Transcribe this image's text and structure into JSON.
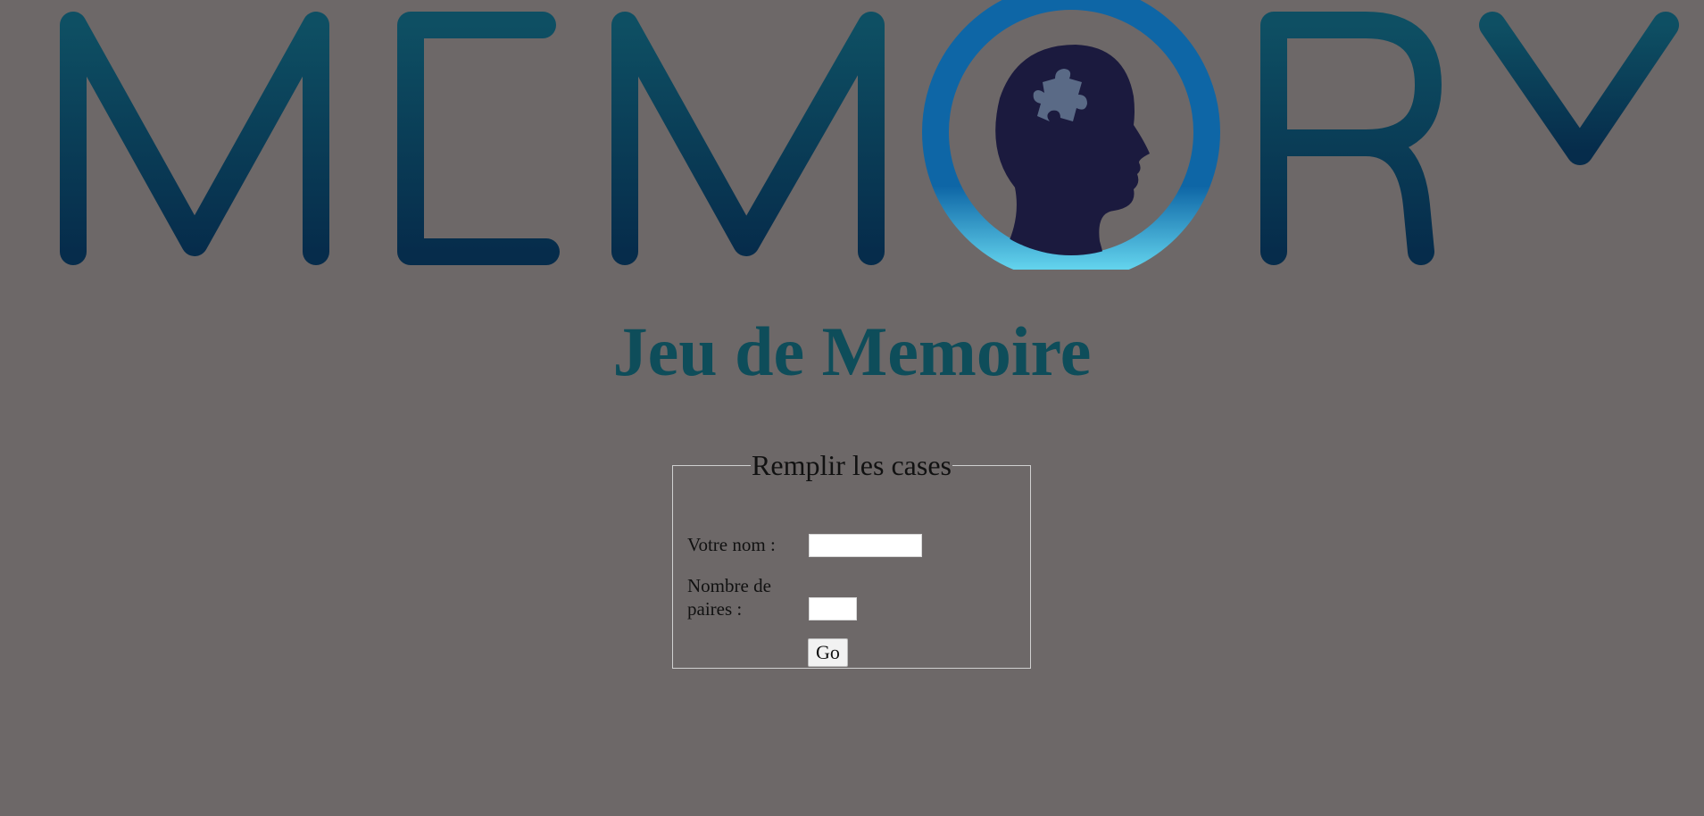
{
  "logo": {
    "text": "MEMORY",
    "icon": "head-puzzle-icon",
    "colors": {
      "letters_top": "#0e4f63",
      "letters_bottom": "#062c4b",
      "ring": "#0e66a6",
      "ring_bottom": "#62d2ec",
      "head": "#1b1a3e",
      "puzzle": "#5a6a86"
    }
  },
  "header": {
    "title": "Jeu de Memoire",
    "title_color": "#0e4d5a"
  },
  "form": {
    "legend": "Remplir les cases",
    "name_label": "Votre nom :",
    "name_value": "",
    "pairs_label": "Nombre de paires :",
    "pairs_value": "",
    "submit_label": "Go"
  },
  "colors": {
    "background": "#6d6868"
  }
}
